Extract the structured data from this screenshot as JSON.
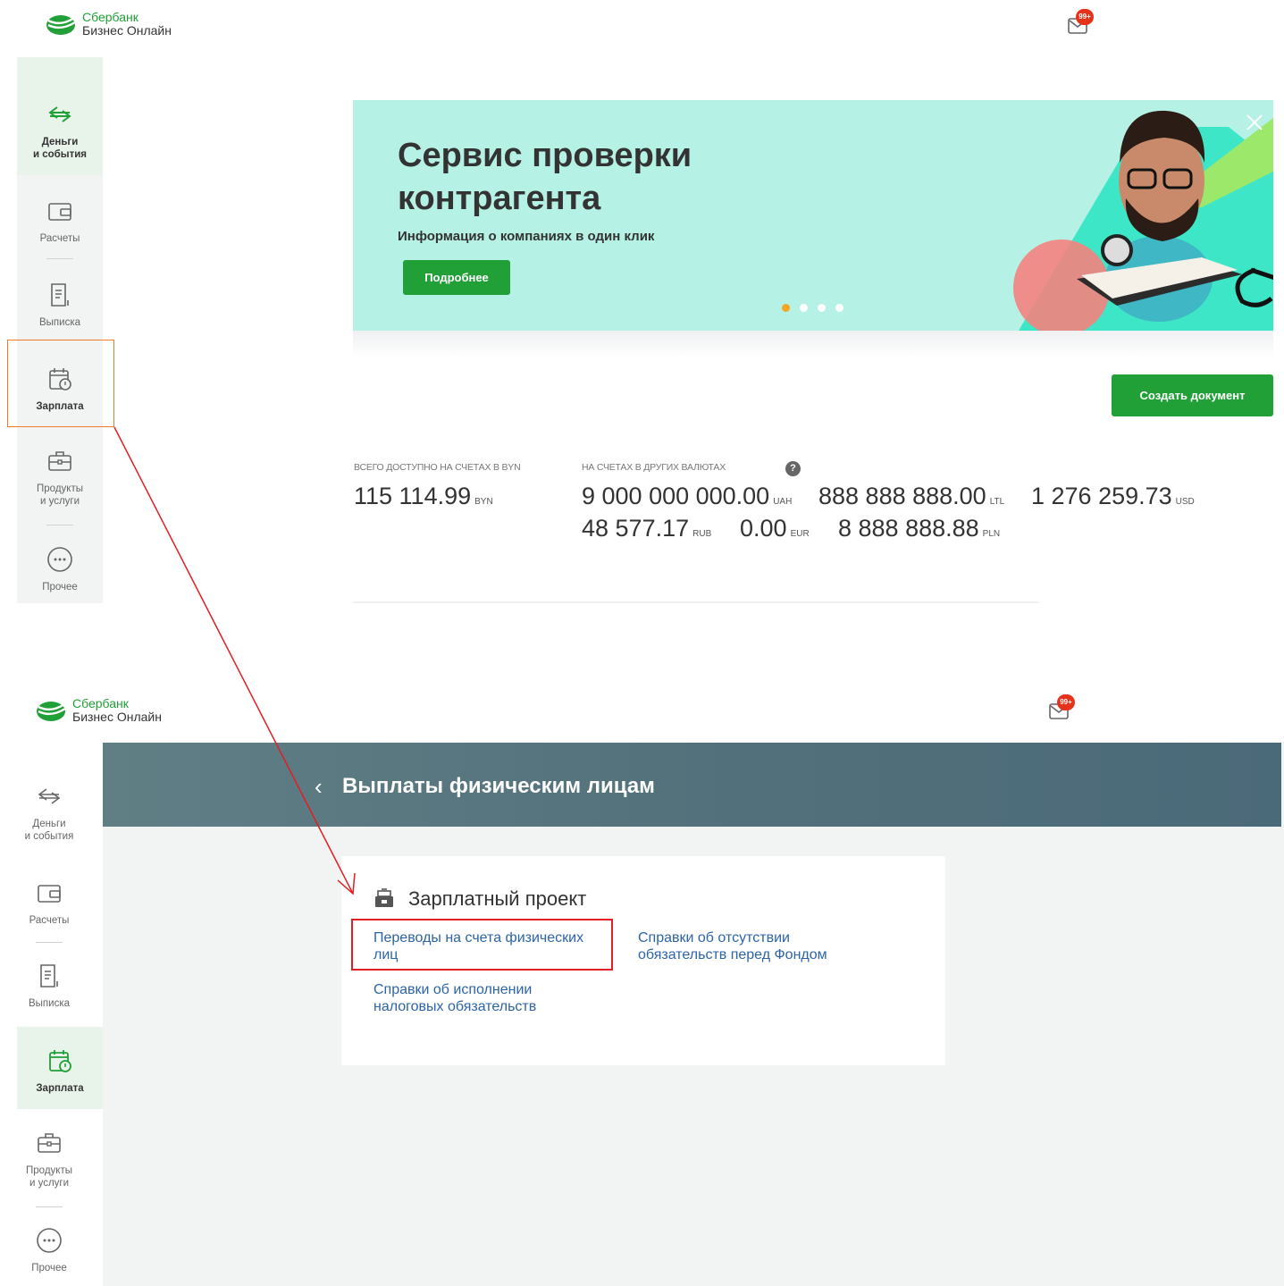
{
  "brand": {
    "line1": "Сбербанк",
    "line2": "Бизнес Онлайн",
    "color": "#21a038"
  },
  "mail": {
    "badge": "99+",
    "icon": "mail-icon"
  },
  "sidebar": {
    "items": [
      {
        "label_line1": "Деньги",
        "label_line2": "и события",
        "icon": "arrows-exchange-icon"
      },
      {
        "label_line1": "Расчеты",
        "label_line2": "",
        "icon": "wallet-icon"
      },
      {
        "label_line1": "Выписка",
        "label_line2": "",
        "icon": "document-icon"
      },
      {
        "label_line1": "Зарплата",
        "label_line2": "",
        "icon": "calendar-clock-icon"
      },
      {
        "label_line1": "Продукты",
        "label_line2": "и услуги",
        "icon": "briefcase-icon"
      },
      {
        "label_line1": "Прочее",
        "label_line2": "",
        "icon": "more-icon"
      }
    ]
  },
  "banner": {
    "title": "Сервис проверки контрагента",
    "subtitle": "Информация о компаниях в один клик",
    "button": "Подробнее",
    "slides_total": 4,
    "slide_active": 1
  },
  "actions": {
    "create_document": "Создать документ"
  },
  "balances": {
    "byn_label": "ВСЕГО ДОСТУПНО НА СЧЕТАХ В BYN",
    "other_label": "НА СЧЕТАХ В ДРУГИХ ВАЛЮТАХ",
    "help": "?",
    "byn": {
      "value": "115 114.99",
      "currency": "BYN"
    },
    "other": [
      {
        "value": "9 000 000 000.00",
        "currency": "UAH"
      },
      {
        "value": "888 888 888.00",
        "currency": "LTL"
      },
      {
        "value": "1 276 259.73",
        "currency": "USD"
      },
      {
        "value": "48 577.17",
        "currency": "RUB"
      },
      {
        "value": "0.00",
        "currency": "EUR"
      },
      {
        "value": "8 888 888.88",
        "currency": "PLN"
      }
    ]
  },
  "payouts": {
    "back": "‹",
    "title": "Выплаты физическим лицам",
    "section_title": "Зарплатный проект",
    "section_icon": "cash-register-icon",
    "links": {
      "transfers": "Переводы на счета физических лиц",
      "fund": "Справки об отсутствии обязательств перед Фондом",
      "tax": "Справки об исполнении налоговых обязательств"
    }
  },
  "annotations": {
    "highlight_color": "#e31e24",
    "sidebar_highlight_color": "#f07a28"
  }
}
